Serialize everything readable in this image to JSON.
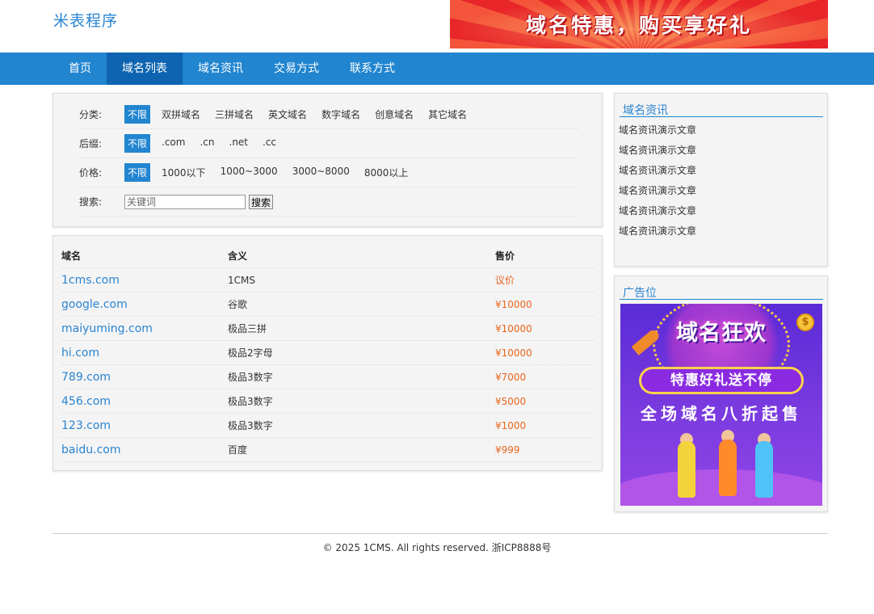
{
  "site": {
    "title": "米表程序"
  },
  "top_banner": {
    "text": "域名特惠，购买享好礼"
  },
  "nav": {
    "items": [
      {
        "label": "首页",
        "active": false
      },
      {
        "label": "域名列表",
        "active": true
      },
      {
        "label": "域名资讯",
        "active": false
      },
      {
        "label": "交易方式",
        "active": false
      },
      {
        "label": "联系方式",
        "active": false
      }
    ]
  },
  "filters": {
    "category": {
      "label": "分类:",
      "options": [
        "不限",
        "双拼域名",
        "三拼域名",
        "英文域名",
        "数字域名",
        "创意域名",
        "其它域名"
      ],
      "selected": "不限"
    },
    "suffix": {
      "label": "后缀:",
      "options": [
        "不限",
        ".com",
        ".cn",
        ".net",
        ".cc"
      ],
      "selected": "不限"
    },
    "price": {
      "label": "价格:",
      "options": [
        "不限",
        "1000以下",
        "1000~3000",
        "3000~8000",
        "8000以上"
      ],
      "selected": "不限"
    },
    "search": {
      "label": "搜索:",
      "placeholder": "关键词",
      "button": "搜索"
    }
  },
  "domain_table": {
    "headers": {
      "domain": "域名",
      "meaning": "含义",
      "price": "售价"
    },
    "rows": [
      {
        "domain": "1cms.com",
        "meaning": "1CMS",
        "price": "议价"
      },
      {
        "domain": "google.com",
        "meaning": "谷歌",
        "price": "¥10000"
      },
      {
        "domain": "maiyuming.com",
        "meaning": "极品三拼",
        "price": "¥10000"
      },
      {
        "domain": "hi.com",
        "meaning": "极品2字母",
        "price": "¥10000"
      },
      {
        "domain": "789.com",
        "meaning": "极品3数字",
        "price": "¥7000"
      },
      {
        "domain": "456.com",
        "meaning": "极品3数字",
        "price": "¥5000"
      },
      {
        "domain": "123.com",
        "meaning": "极品3数字",
        "price": "¥1000"
      },
      {
        "domain": "baidu.com",
        "meaning": "百度",
        "price": "¥999"
      }
    ]
  },
  "news": {
    "title": "域名资讯",
    "items": [
      "域名资讯演示文章",
      "域名资讯演示文章",
      "域名资讯演示文章",
      "域名资讯演示文章",
      "域名资讯演示文章",
      "域名资讯演示文章"
    ]
  },
  "ad": {
    "title": "广告位",
    "image_title": "域名狂欢",
    "image_pill": "特惠好礼送不停",
    "image_line": "全场域名八折起售"
  },
  "footer": {
    "text": "© 2025 1CMS. All rights reserved. 浙ICP8888号"
  },
  "colors": {
    "brand_blue": "#2185d0",
    "nav_active": "#0e64b0",
    "price_orange": "#e8661c",
    "link_blue": "#2a84d1"
  }
}
